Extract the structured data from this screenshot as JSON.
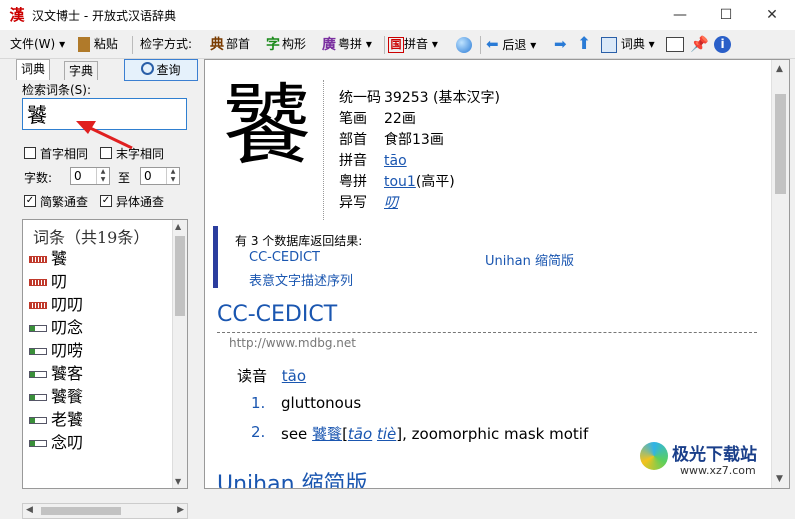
{
  "window": {
    "app_icon_char": "漢",
    "title": "汉文博士 - 开放式汉语辞典",
    "minimize": "—",
    "maximize": "☐",
    "close": "✕"
  },
  "toolbar": {
    "file": "文件(W)",
    "paste": "粘贴",
    "lookup_method_label": "检字方式:",
    "radical": "部首",
    "shape": "构形",
    "cantonese": "粤拼",
    "pinyin": "拼音",
    "back": "后退",
    "dictionary": "词典",
    "icons": {
      "radical": "典",
      "shape": "字",
      "cantonese": "廣",
      "pinyin": "国"
    }
  },
  "left": {
    "tabs": [
      "词典",
      "字典"
    ],
    "query_button": "查询",
    "search_label": "检索词条(S):",
    "search_value": "饕",
    "first_char_same": "首字相同",
    "last_char_same": "末字相同",
    "char_count_label": "字数:",
    "count_from": "0",
    "to_label": "至",
    "count_to": "0",
    "simplified_traditional": "简繁通查",
    "variant": "异体通查",
    "list_header": "词条（共19条）",
    "items": [
      {
        "text": "饕",
        "icon": "red"
      },
      {
        "text": "叨",
        "icon": "red"
      },
      {
        "text": "叨叨",
        "icon": "red"
      },
      {
        "text": "叨念",
        "icon": "green"
      },
      {
        "text": "叨唠",
        "icon": "green"
      },
      {
        "text": "饕客",
        "icon": "green"
      },
      {
        "text": "饕餮",
        "icon": "green"
      },
      {
        "text": "老饕",
        "icon": "green"
      },
      {
        "text": "念叨",
        "icon": "green"
      }
    ]
  },
  "entry": {
    "character": "饕",
    "props": [
      {
        "key": "统一码",
        "value": "39253 (基本汉字)",
        "link": ""
      },
      {
        "key": "笔画",
        "value": "22画",
        "link": ""
      },
      {
        "key": "部首",
        "value": "食部13画",
        "link": ""
      },
      {
        "key": "拼音",
        "value": "",
        "link": "tāo"
      },
      {
        "key": "粤拼",
        "value": "(高平)",
        "link": "tou1"
      },
      {
        "key": "异写",
        "value": "",
        "link": "叨"
      }
    ],
    "notice_title": "有 3 个数据库返回结果:",
    "notice_links": [
      "CC-CEDICT",
      "Unihan 缩简版",
      "表意文字描述序列"
    ],
    "cedict_title": "CC-CEDICT",
    "cedict_url": "http://www.mdbg.net",
    "reading_label": "读音",
    "reading_value": "tāo",
    "senses": [
      {
        "num": "1.",
        "text": "gluttonous"
      },
      {
        "num": "2.",
        "pre": "see ",
        "word": "饕餮",
        "bracket_open": "[",
        "py1": "tāo",
        "py2": "tiè",
        "post": "], zoomorphic mask motif"
      }
    ],
    "unihan_title": "Unihan 缩简版"
  },
  "watermark": {
    "text": "极光下载站",
    "url": "www.xz7.com"
  }
}
